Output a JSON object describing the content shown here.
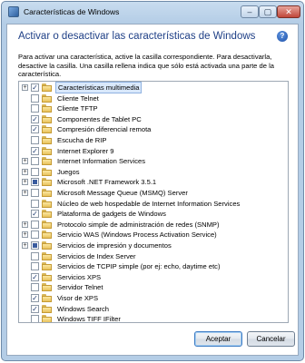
{
  "window": {
    "title": "Características de Windows",
    "controls": {
      "minimize": "–",
      "maximize": "▢",
      "close": "✕"
    }
  },
  "heading": "Activar o desactivar las características de Windows",
  "help_icon": "?",
  "description": "Para activar una característica, active la casilla correspondiente. Para desactivarla, desactive la casilla. Una casilla rellena indica que sólo está activada una parte de la característica.",
  "features": [
    {
      "label": "Características multimedia",
      "expandable": true,
      "state": "checked",
      "selected": true
    },
    {
      "label": "Cliente Telnet",
      "expandable": false,
      "state": "unchecked"
    },
    {
      "label": "Cliente TFTP",
      "expandable": false,
      "state": "unchecked"
    },
    {
      "label": "Componentes de Tablet PC",
      "expandable": false,
      "state": "checked"
    },
    {
      "label": "Compresión diferencial remota",
      "expandable": false,
      "state": "checked"
    },
    {
      "label": "Escucha de RIP",
      "expandable": false,
      "state": "unchecked"
    },
    {
      "label": "Internet Explorer 9",
      "expandable": false,
      "state": "checked"
    },
    {
      "label": "Internet Information Services",
      "expandable": true,
      "state": "unchecked"
    },
    {
      "label": "Juegos",
      "expandable": true,
      "state": "unchecked"
    },
    {
      "label": "Microsoft .NET Framework 3.5.1",
      "expandable": true,
      "state": "partial"
    },
    {
      "label": "Microsoft Message Queue (MSMQ) Server",
      "expandable": true,
      "state": "unchecked"
    },
    {
      "label": "Núcleo de web hospedable de Internet Information Services",
      "expandable": false,
      "state": "unchecked"
    },
    {
      "label": "Plataforma de gadgets de Windows",
      "expandable": false,
      "state": "checked"
    },
    {
      "label": "Protocolo simple de administración de redes (SNMP)",
      "expandable": true,
      "state": "unchecked"
    },
    {
      "label": "Servicio WAS (Windows Process Activation Service)",
      "expandable": true,
      "state": "unchecked"
    },
    {
      "label": "Servicios de impresión y documentos",
      "expandable": true,
      "state": "partial"
    },
    {
      "label": "Servicios de Index Server",
      "expandable": false,
      "state": "unchecked"
    },
    {
      "label": "Servicios de TCPIP simple (por ej: echo, daytime etc)",
      "expandable": false,
      "state": "unchecked"
    },
    {
      "label": "Servicios XPS",
      "expandable": false,
      "state": "checked"
    },
    {
      "label": "Servidor Telnet",
      "expandable": false,
      "state": "unchecked"
    },
    {
      "label": "Visor de XPS",
      "expandable": false,
      "state": "checked"
    },
    {
      "label": "Windows Search",
      "expandable": false,
      "state": "checked"
    },
    {
      "label": "Windows TIFF IFilter",
      "expandable": false,
      "state": "unchecked"
    }
  ],
  "buttons": {
    "ok": "Aceptar",
    "cancel": "Cancelar"
  }
}
